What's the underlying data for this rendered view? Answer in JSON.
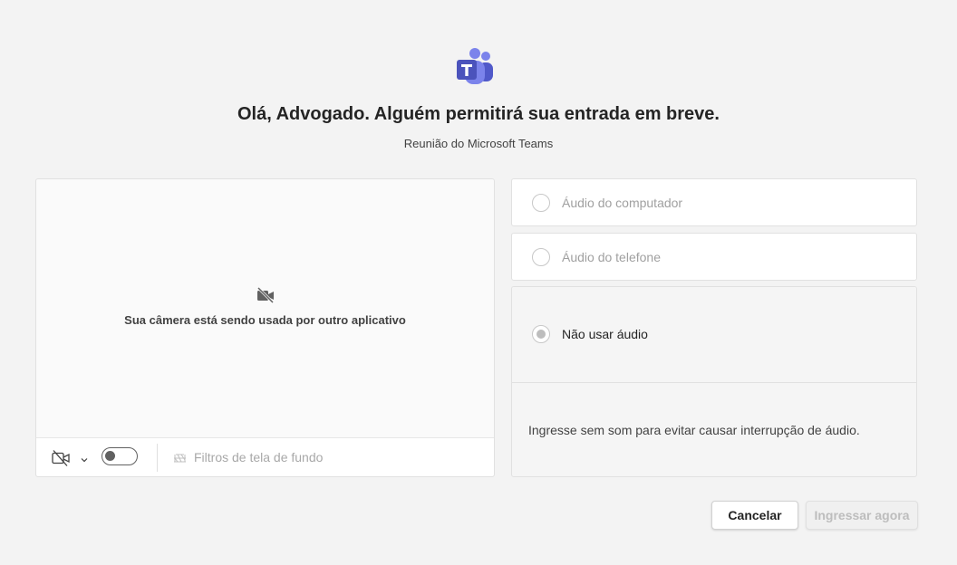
{
  "header": {
    "logo_icon": "teams-logo-icon",
    "title": "Olá, Advogado. Alguém permitirá sua entrada em breve.",
    "subtitle": "Reunião do Microsoft Teams"
  },
  "video": {
    "camera_message": "Sua câmera está sendo usada por outro aplicativo",
    "camera_message_icon": "camera-off-icon",
    "toolbar": {
      "camera_icon": "camera-off-icon",
      "camera_chevron_icon": "chevron-down-icon",
      "camera_toggle_on": false,
      "background_filters_label": "Filtros de tela de fundo",
      "background_filters_icon": "background-effects-icon"
    }
  },
  "audio": {
    "options": [
      {
        "label": "Áudio do computador",
        "selected": false
      },
      {
        "label": "Áudio do telefone",
        "selected": false
      },
      {
        "label": "Não usar áudio",
        "selected": true
      }
    ],
    "no_audio_description": "Ingresse sem som para evitar causar interrupção de áudio."
  },
  "actions": {
    "cancel_label": "Cancelar",
    "join_label": "Ingressar agora",
    "join_enabled": false
  },
  "colors": {
    "brand": "#5b5fc7",
    "background": "#f3f3f3"
  }
}
